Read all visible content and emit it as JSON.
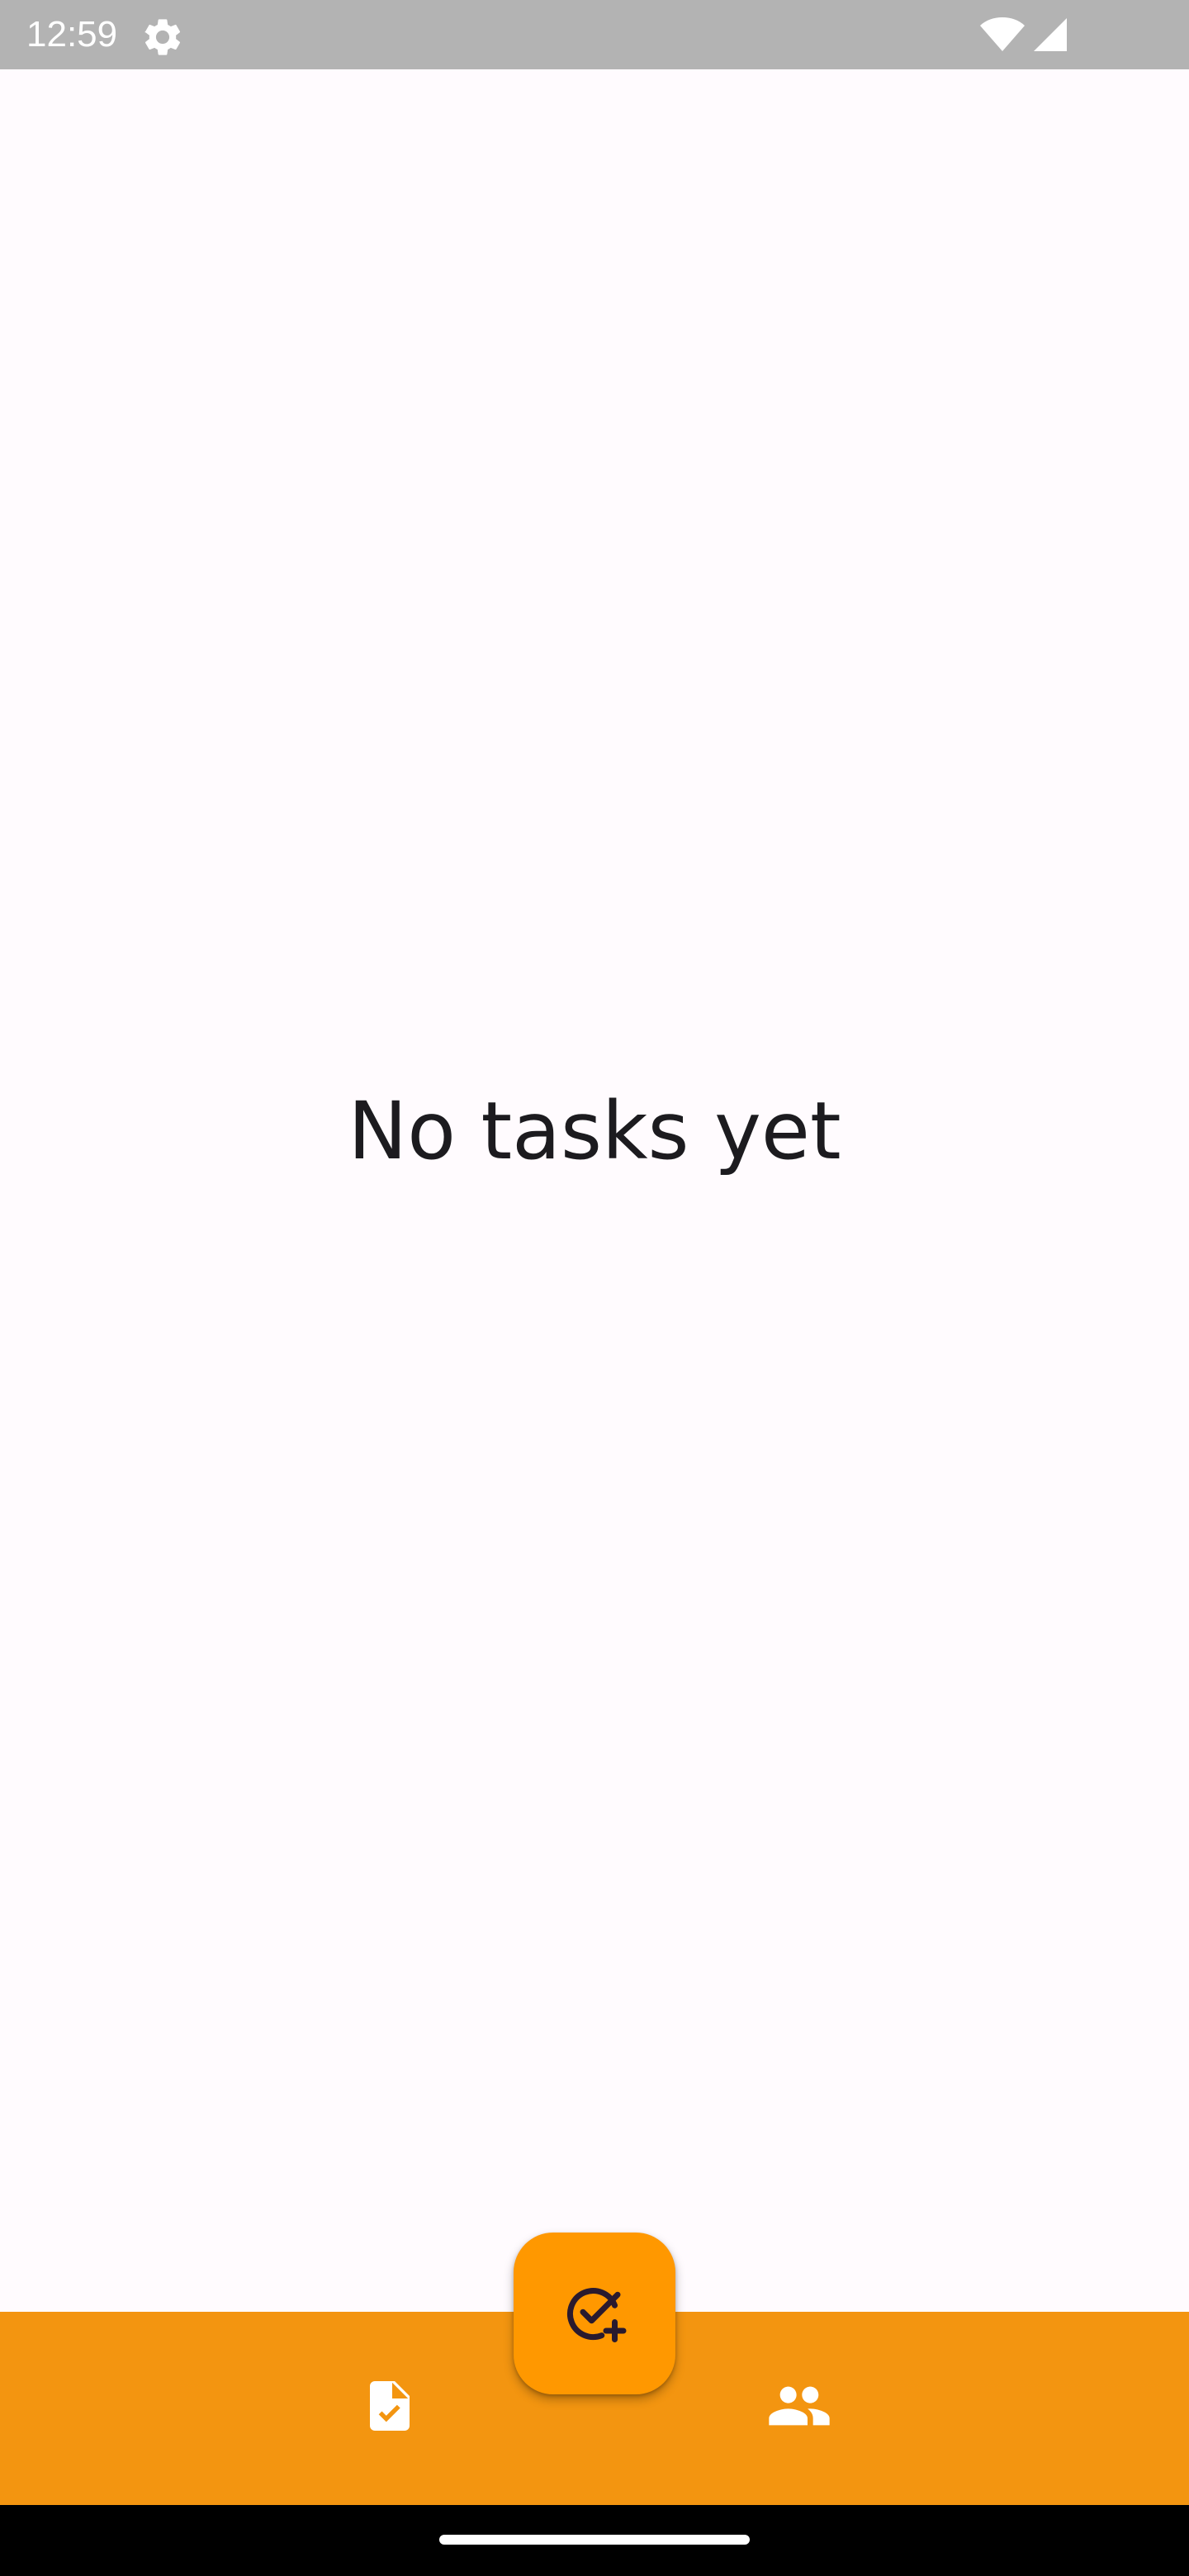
{
  "status_bar": {
    "time": "12:59",
    "icons": [
      "settings-icon",
      "wifi-icon",
      "signal-icon"
    ]
  },
  "main": {
    "empty_message": "No tasks yet"
  },
  "fab": {
    "icon": "add-task-icon"
  },
  "bottom_nav": {
    "items": [
      {
        "icon": "task-document-icon"
      },
      {
        "icon": "people-icon"
      }
    ]
  },
  "colors": {
    "accent": "#ff9800",
    "bottom_bar": "#f39510",
    "background": "#fffbfe",
    "status_bar": "#b3b3b3"
  }
}
